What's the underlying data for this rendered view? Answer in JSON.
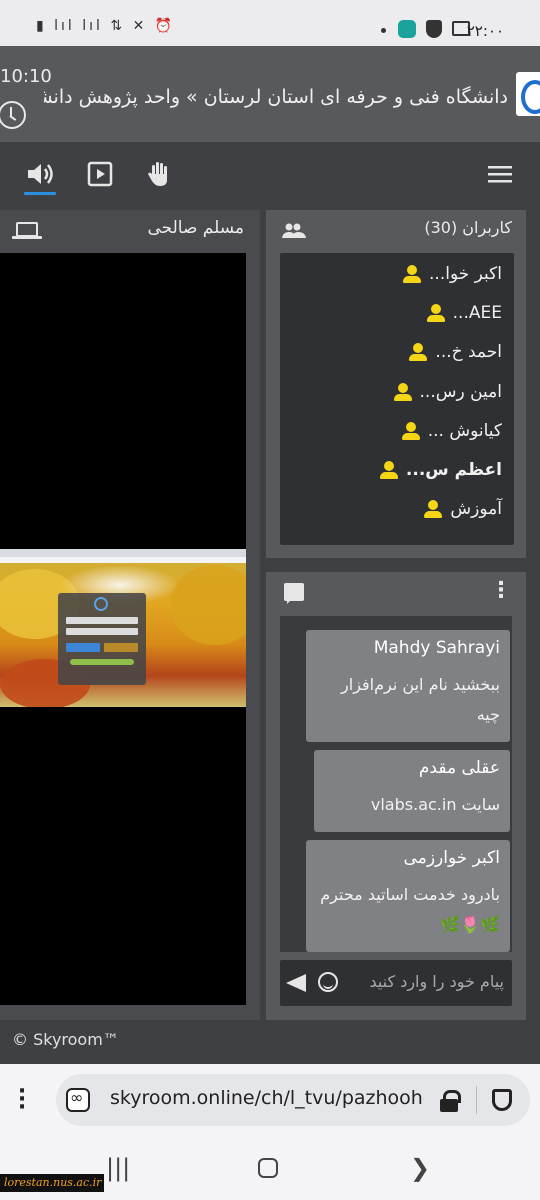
{
  "status_bar": {
    "clock": "۲۲:۰۰",
    "left_icons": "▮ lıl lıl ⇅ ✕ ⏰",
    "right_icons": [
      "shield-check-icon",
      "shield-icon",
      "image-icon"
    ]
  },
  "header": {
    "time": "10:10",
    "title": "دانشگاه فنی و حرفه ای استان لرستان » واحد پژوهش دانشگاه"
  },
  "toolbar": {
    "buttons": [
      "speaker-icon",
      "play-icon",
      "hand-icon",
      "hamburger-menu-icon"
    ],
    "accent": "#2b8fe0"
  },
  "video": {
    "presenter_name": "مسلم صالحی"
  },
  "users": {
    "title": "کاربران (30)",
    "list": [
      {
        "name": "اکبر خوا...",
        "bold": false
      },
      {
        "name": "AEE...",
        "bold": false
      },
      {
        "name": "احمد خ...",
        "bold": false
      },
      {
        "name": "امین رس...",
        "bold": false
      },
      {
        "name": "کیانوش ...",
        "bold": false
      },
      {
        "name": "اعظم س...",
        "bold": true
      },
      {
        "name": "آموزش",
        "bold": false
      }
    ],
    "icon_color": "#f5d617"
  },
  "chat": {
    "messages": [
      {
        "author": "Mahdy Sahrayi",
        "text": "ببخشید   نام این نرم‌افزار   چیه"
      },
      {
        "author": "عقلی مقدم",
        "text": "سایت vlabs.ac.in"
      },
      {
        "author": "اکبر خوارزمی",
        "text": "بادرود خدمت اساتید محترم🌿🌷🌿"
      }
    ],
    "input_placeholder": "پیام خود را وارد کنید"
  },
  "footer": {
    "copyright": "© Skyroom™"
  },
  "browser": {
    "url": "skyroom.online/ch/l_tvu/pazhoohesh"
  },
  "watermark": "lorestan.nus.ac.ir",
  "nav": {
    "recents": "|||",
    "back": "❯"
  }
}
